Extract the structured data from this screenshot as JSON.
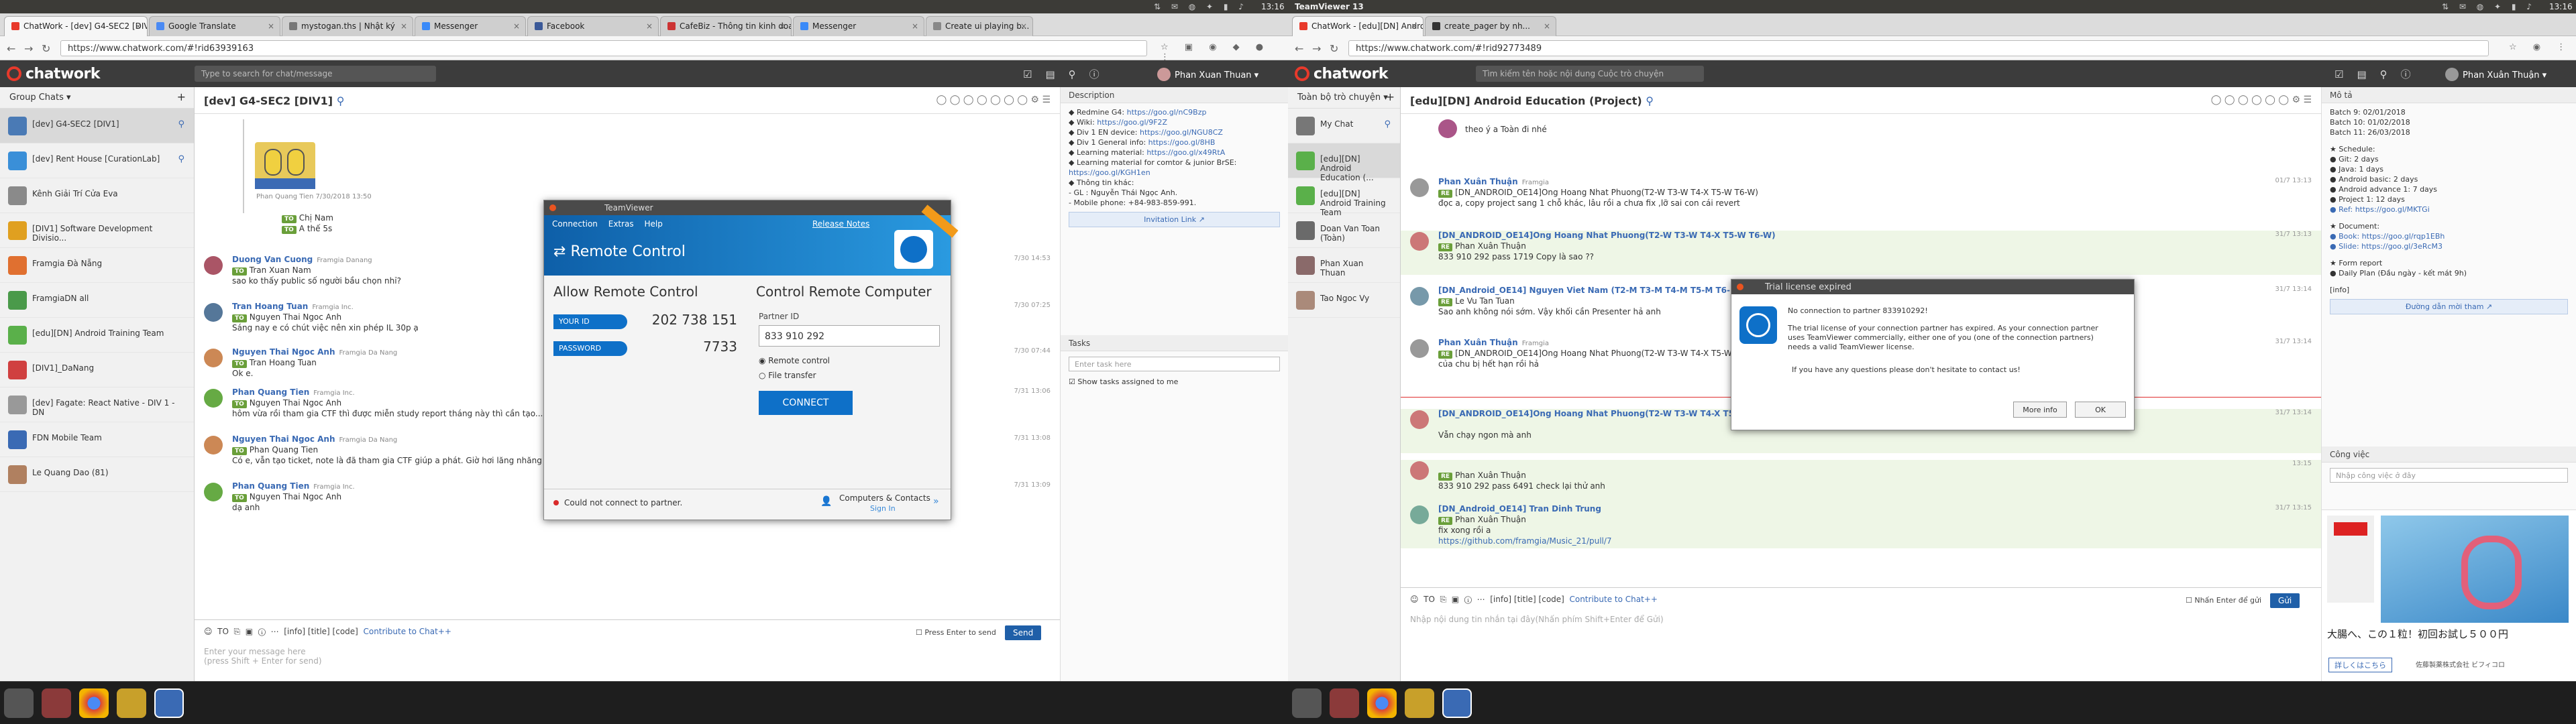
{
  "topbar": {
    "left_time": "13:16",
    "center_title": "TeamViewer 13",
    "right_time": "13:16"
  },
  "left_browser": {
    "tabs": [
      "ChatWork - [dev] G4-SEC2 [DIV1]",
      "Google Translate",
      "mystogan.ths | Nhật ký",
      "Messenger",
      "Facebook",
      "CafeBiz - Thông tin kinh doanh",
      "Messenger",
      "Create ui playing b..."
    ],
    "url": "https://www.chatwork.com/#!rid63939163",
    "search_placeholder": "Type to search for chat/message",
    "user_name": "Phan Xuan Thuan"
  },
  "left_sidebar": {
    "header": "Group Chats",
    "items": [
      {
        "label": "[dev] G4-SEC2 [DIV1]",
        "color": "#4a7ab5",
        "pinned": true
      },
      {
        "label": "[dev] Rent House [CurationLab]",
        "color": "#3a8fd8",
        "pinned": true
      },
      {
        "label": "Kênh Giải Trí Cửa Eva",
        "color": "#8a8a8a",
        "pinned": false
      },
      {
        "label": "[DIV1] Software Development Divisio...",
        "color": "#e0a020",
        "pinned": false
      },
      {
        "label": "Framgia Đà Nẵng",
        "color": "#e07030",
        "pinned": false
      },
      {
        "label": "FramgiaDN all",
        "color": "#4a9a4a",
        "pinned": false
      },
      {
        "label": "[edu][DN] Android Training Team",
        "color": "#5ab04a",
        "pinned": false
      },
      {
        "label": "[DIV1]_DaNang",
        "color": "#d04040",
        "pinned": false
      },
      {
        "label": "[dev] Fagate: React Native - DIV 1 - DN",
        "color": "#999999",
        "pinned": false
      },
      {
        "label": "FDN Mobile Team",
        "color": "#3a6ab4",
        "pinned": false
      },
      {
        "label": "Le Quang Dao (81)",
        "color": "#b08060",
        "pinned": false
      }
    ]
  },
  "left_room": {
    "title": "[dev] G4-SEC2 [DIV1]",
    "quote_author": "Phan Quang Tien",
    "quote_time": "7/30/2018 13:50",
    "quote_to": "Chị Nam",
    "quote_text": "A thế 5s",
    "messages": [
      {
        "name": "Duong Van Cuong",
        "org": "Framgia Danang",
        "time": "7/30 14:53",
        "to": "Tran Xuan Nam",
        "text": "sao ko thấy public số người bầu chọn nhỉ?"
      },
      {
        "name": "Tran Hoang Tuan",
        "org": "Framgia Inc.",
        "time": "7/30 07:25",
        "to": "Nguyen Thai Ngoc Anh",
        "text": "Sáng nay e có chút việc nên xin phép IL 30p ạ"
      },
      {
        "name": "Nguyen Thai Ngoc Anh",
        "org": "Framgia Da Nang",
        "time": "7/30 07:44",
        "to": "Tran Hoang Tuan",
        "text": "Ok e."
      },
      {
        "name": "Phan Quang Tien",
        "org": "Framgia Inc.",
        "time": "7/31 13:06",
        "to": "Nguyen Thai Ngoc Anh",
        "text": "hôm vừa rồi tham gia CTF thì được miễn study report tháng này thì cần tạo..."
      },
      {
        "name": "Nguyen Thai Ngoc Anh",
        "org": "Framgia Da Nang",
        "time": "7/31 13:08",
        "to": "Phan Quang Tien",
        "text": "Có e, vẫn tạo ticket, note là đã tham gia CTF giúp a phát. Giờ hơi lăng nhăng vì mấy ông manager có e thư ký chuyển đi kiểm tra rồi."
      },
      {
        "name": "Phan Quang Tien",
        "org": "Framgia Inc.",
        "time": "7/31 13:09",
        "to": "Nguyen Thai Ngoc Anh",
        "text": "dạ anh"
      }
    ],
    "input_tools": "[info]  [title]  [code]",
    "contribute": "Contribute to Chat++",
    "placeholder": "Enter your message here",
    "placeholder2": "(press Shift + Enter for send)",
    "press_enter": "Press Enter to send",
    "send": "Send"
  },
  "left_panel": {
    "desc_title": "Description",
    "desc_lines": [
      {
        "label": "◆ Redmine G4: ",
        "link": "https://goo.gl/nC9Bzp"
      },
      {
        "label": "◆ Wiki: ",
        "link": "https://goo.gl/9F2Z"
      },
      {
        "label": "◆ Div 1 EN device: ",
        "link": "https://goo.gl/NGU8CZ"
      },
      {
        "label": "◆ Div 1 General info: ",
        "link": "https://goo.gl/8HB"
      },
      {
        "label": "◆ Learning material: ",
        "link": "https://goo.gl/x49RtA"
      },
      {
        "label": "◆ Learning material for comtor & junior BrSE:",
        "link": ""
      },
      {
        "label": "",
        "link": "https://goo.gl/KGH1en"
      },
      {
        "label": "◆ Thông tin khác:",
        "link": ""
      },
      {
        "label": "  - GL : Nguyễn Thái Ngọc Anh.",
        "link": ""
      },
      {
        "label": "  - Mobile phone: +84-983-859-991.",
        "link": ""
      }
    ],
    "invitation": "Invitation Link",
    "tasks_title": "Tasks",
    "task_placeholder": "Enter task here",
    "show_tasks": "Show tasks assigned to me"
  },
  "teamviewer": {
    "title": "TeamViewer",
    "menu": [
      "Connection",
      "Extras",
      "Help"
    ],
    "release_notes": "Release Notes",
    "banner": "Remote Control",
    "allow_title": "Allow Remote Control",
    "your_id_label": "YOUR ID",
    "your_id": "202 738 151",
    "password_label": "PASSWORD",
    "password": "7733",
    "control_title": "Control Remote Computer",
    "partner_label": "Partner ID",
    "partner_id": "833 910 292",
    "opt1": "Remote control",
    "opt2": "File transfer",
    "connect": "CONNECT",
    "status": "Could not connect to partner.",
    "contacts": "Computers & Contacts",
    "sign_in": "Sign In"
  },
  "right_browser": {
    "tabs": [
      "ChatWork - [edu][DN] Android...",
      "create_pager by nh..."
    ],
    "url": "https://www.chatwork.com/#!rid92773489",
    "search_placeholder": "Tìm kiếm tên hoặc nội dung Cuộc trò chuyện",
    "user_name": "Phan Xuân Thuận"
  },
  "right_sidebar": {
    "header": "Toàn bộ trò chuyện",
    "items": [
      {
        "label": "My Chat",
        "color": "#777777",
        "pinned": true
      },
      {
        "label": "[edu][DN] Android Education (...",
        "color": "#5ab04a",
        "pinned": false
      },
      {
        "label": "[edu][DN] Android Training Team",
        "color": "#5ab04a",
        "pinned": false
      },
      {
        "label": "Doan Van Toan (Toàn)",
        "color": "#6a6a6a",
        "pinned": false
      },
      {
        "label": "Phan Xuan Thuan",
        "color": "#8a6a6a",
        "pinned": false
      },
      {
        "label": "Tao Ngoc Vy",
        "color": "#aa8a7a",
        "pinned": false
      }
    ]
  },
  "right_room": {
    "title": "[edu][DN] Android Education (Project)",
    "top_text": "theo ý a Toàn đi nhé",
    "messages": [
      {
        "name": "Phan Xuân Thuận",
        "org": "Framgia",
        "time": "01/7 13:13",
        "to": "[DN_ANDROID_OE14]Ong Hoang Nhat Phuong(T2-W T3-W T4-X T5-W T6-W)",
        "text": "đọc a, copy project sang 1 chỗ khác, lâu rồi a chưa fix ,lỡ sai con cái revert"
      },
      {
        "name": "[DN_ANDROID_OE14]Ong Hoang Nhat Phuong(T2-W T3-W T4-X T5-W T6-W)",
        "org": "",
        "time": "31/7 13:13",
        "to": "Phan Xuân Thuận",
        "text": "833 910 292 pass 1719 Copy là sao ??"
      },
      {
        "name": "[DN_Android_OE14] Nguyen Viet Nam (T2-M T3-M T4-M T5-M T6-M)",
        "org": "",
        "time": "31/7 13:14",
        "to": "Le Vu Tan Tuan",
        "text": "Sao anh không nói sớm. Vậy khối cần Presenter hả anh"
      },
      {
        "name": "Phan Xuân Thuận",
        "org": "Framgia",
        "time": "31/7 13:14",
        "to": "[DN_ANDROID_OE14]Ong Hoang Nhat Phuong(T2-W T3-W T4-X T5-W T6-W)",
        "text": "của chu bị hết hạn rồi hả"
      },
      {
        "name": "[DN_ANDROID_OE14]Ong Hoang Nhat Phuong(T2-W T3-W T4-X T5-W T6-W)",
        "org": "",
        "time": "31/7 13:14",
        "to": "",
        "text": "Vẫn chạy ngon mà anh"
      },
      {
        "name": "",
        "org": "",
        "time": "13:15",
        "to": "Phan Xuân Thuận",
        "text": "833 910 292 pass 6491 check lại thử anh"
      },
      {
        "name": "[DN_Android_OE14] Tran Dinh Trung",
        "org": "",
        "time": "31/7 13:15",
        "to": "Phan Xuân Thuận",
        "text": "fix xong rồi a"
      }
    ],
    "link": "https://github.com/framgia/Music_21/pull/7",
    "input_tools": "[info]  [title]  [code]",
    "contribute": "Contribute to Chat++",
    "placeholder": "Nhập nội dung tin nhắn tại đây(Nhấn phím Shift+Enter để Gửi)",
    "press_enter": "Nhấn Enter để gửi",
    "send": "Gửi"
  },
  "right_panel": {
    "desc_title": "Mô tả",
    "lines": [
      "Batch 9: 02/01/2018",
      "Batch 10: 01/02/2018",
      "Batch 11: 26/03/2018",
      "",
      "★ Schedule:",
      "● Git: 2 days",
      "● Java: 1 days",
      "● Android basic: 2 days",
      "● Android advance 1: 7 days",
      "● Project 1: 12 days",
      "● Ref: https://goo.gl/MKTGi",
      "",
      "★ Document:",
      "● Book: https://goo.gl/rqp1EBh",
      "● Slide: https://goo.gl/3eRcM3",
      "",
      "★ Form report",
      "● Daily Plan (Đầu ngày - kết mát 9h)",
      "",
      "[info]"
    ],
    "invite": "Đường dẫn mời tham",
    "tasks_title": "Công việc",
    "task_placeholder": "Nhập công việc ở đây",
    "ad_text": "大腸へ、この１粒！初回お試し５００円",
    "ad_button": "詳しくはこちら",
    "ad_note": "佐藤製薬株式会社 ビフィコロ"
  },
  "trial_dialog": {
    "title": "Trial license expired",
    "line1": "No connection to partner 833910292!",
    "line2": "The trial license of your connection partner has expired. As your connection partner uses TeamViewer commercially, either one of you (one of the connection partners) needs a valid TeamViewer license.",
    "line3": "If you have any questions please don't hesitate to contact us!",
    "more": "More info",
    "ok": "OK"
  }
}
